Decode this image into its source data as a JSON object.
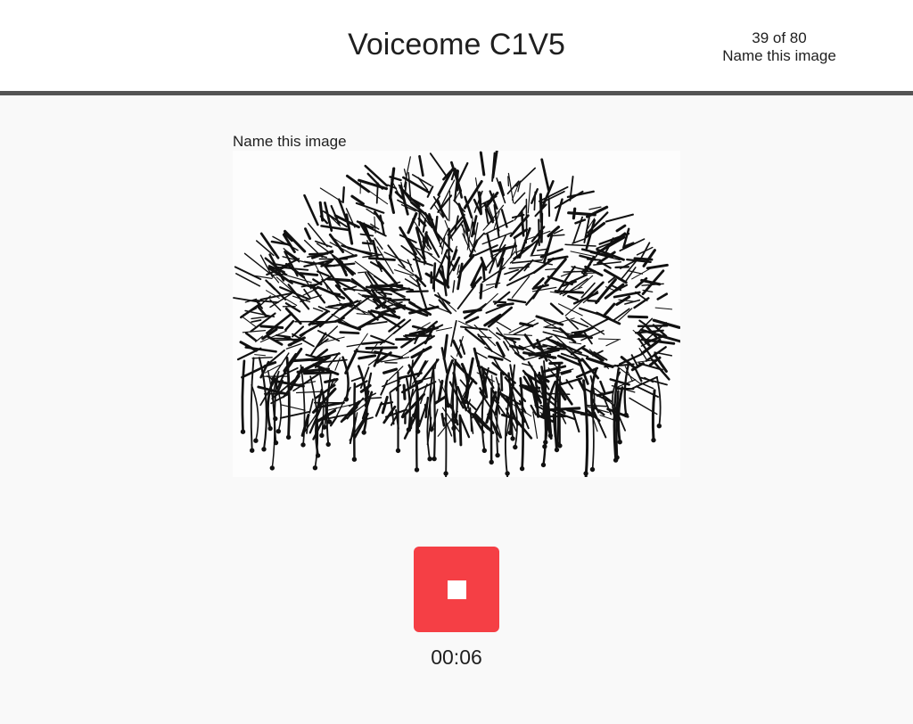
{
  "header": {
    "title": "Voiceome C1V5",
    "progress_count": "39 of 80",
    "progress_task": "Name this image"
  },
  "task": {
    "prompt": "Name this image",
    "image_subject": "sea-urchin-illustration"
  },
  "recorder": {
    "button_icon": "stop-icon",
    "button_color": "#f53f45",
    "elapsed": "00:06"
  }
}
